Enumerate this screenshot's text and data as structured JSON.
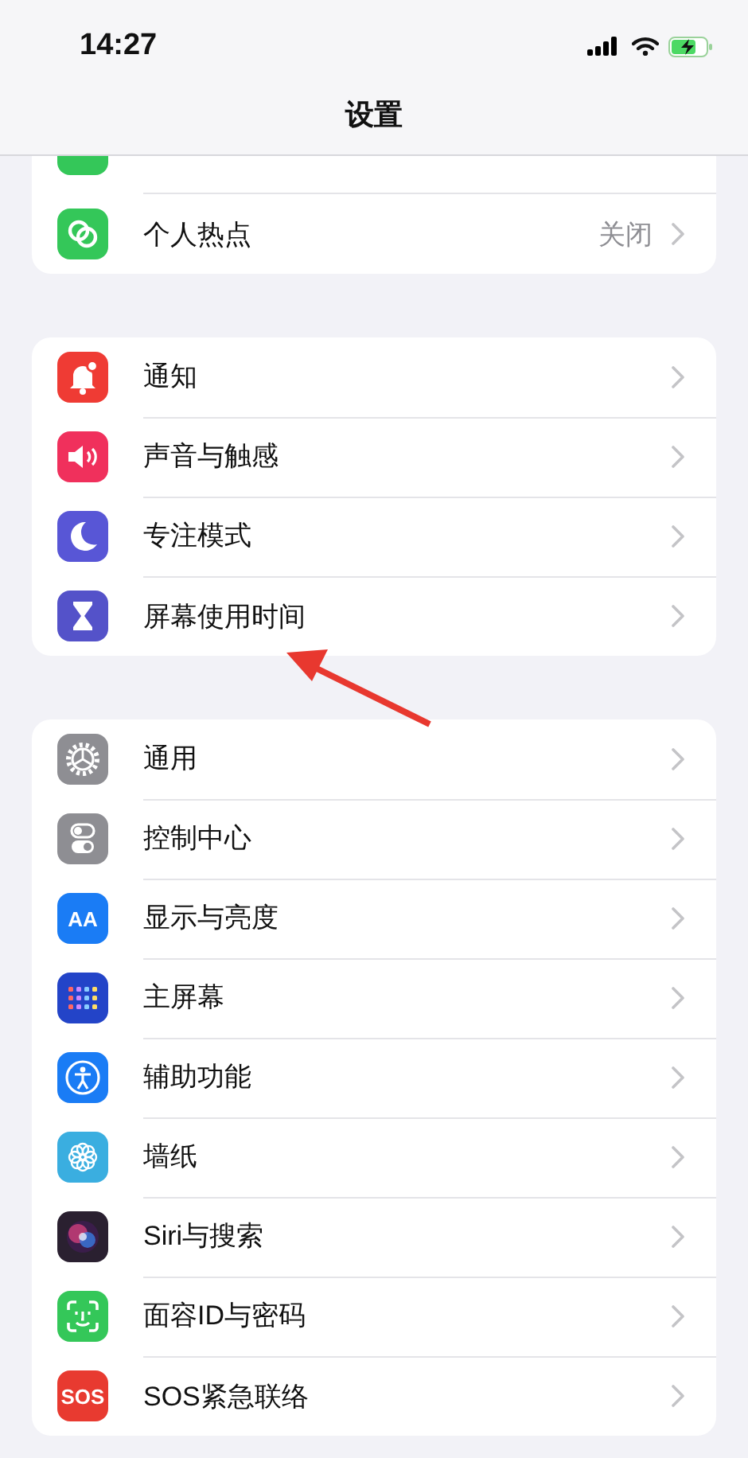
{
  "status_bar": {
    "time": "14:27"
  },
  "nav": {
    "title": "设置"
  },
  "partial_item": {
    "color": "#34c759"
  },
  "groups": [
    {
      "items": [
        {
          "kind": "hotspot",
          "color": "#34c759",
          "label": "个人热点",
          "value": "关闭"
        }
      ]
    },
    {
      "items": [
        {
          "kind": "bell",
          "color": "#ef3b34",
          "label": "通知"
        },
        {
          "kind": "speaker",
          "color": "#f0305c",
          "label": "声音与触感"
        },
        {
          "kind": "moon",
          "color": "#5856d6",
          "label": "专注模式"
        },
        {
          "kind": "hourglass",
          "color": "#5452c9",
          "label": "屏幕使用时间"
        }
      ]
    },
    {
      "items": [
        {
          "kind": "gear",
          "color": "#8e8e93",
          "label": "通用"
        },
        {
          "kind": "toggles",
          "color": "#8e8e93",
          "label": "控制中心"
        },
        {
          "kind": "glyph",
          "color": "#1a7cf5",
          "glyph": "AA",
          "label": "显示与亮度"
        },
        {
          "kind": "grid",
          "color": "#2344c8",
          "label": "主屏幕"
        },
        {
          "kind": "accessibility",
          "color": "#1a7cf5",
          "label": "辅助功能"
        },
        {
          "kind": "flower",
          "color": "#3aaee0",
          "label": "墙纸"
        },
        {
          "kind": "siri",
          "color": "#2a2030",
          "label": "Siri与搜索"
        },
        {
          "kind": "faceid",
          "color": "#34c759",
          "label": "面容ID与密码"
        },
        {
          "kind": "glyph",
          "color": "#e83a30",
          "glyph": "SOS",
          "label": "SOS紧急联络"
        }
      ]
    }
  ]
}
